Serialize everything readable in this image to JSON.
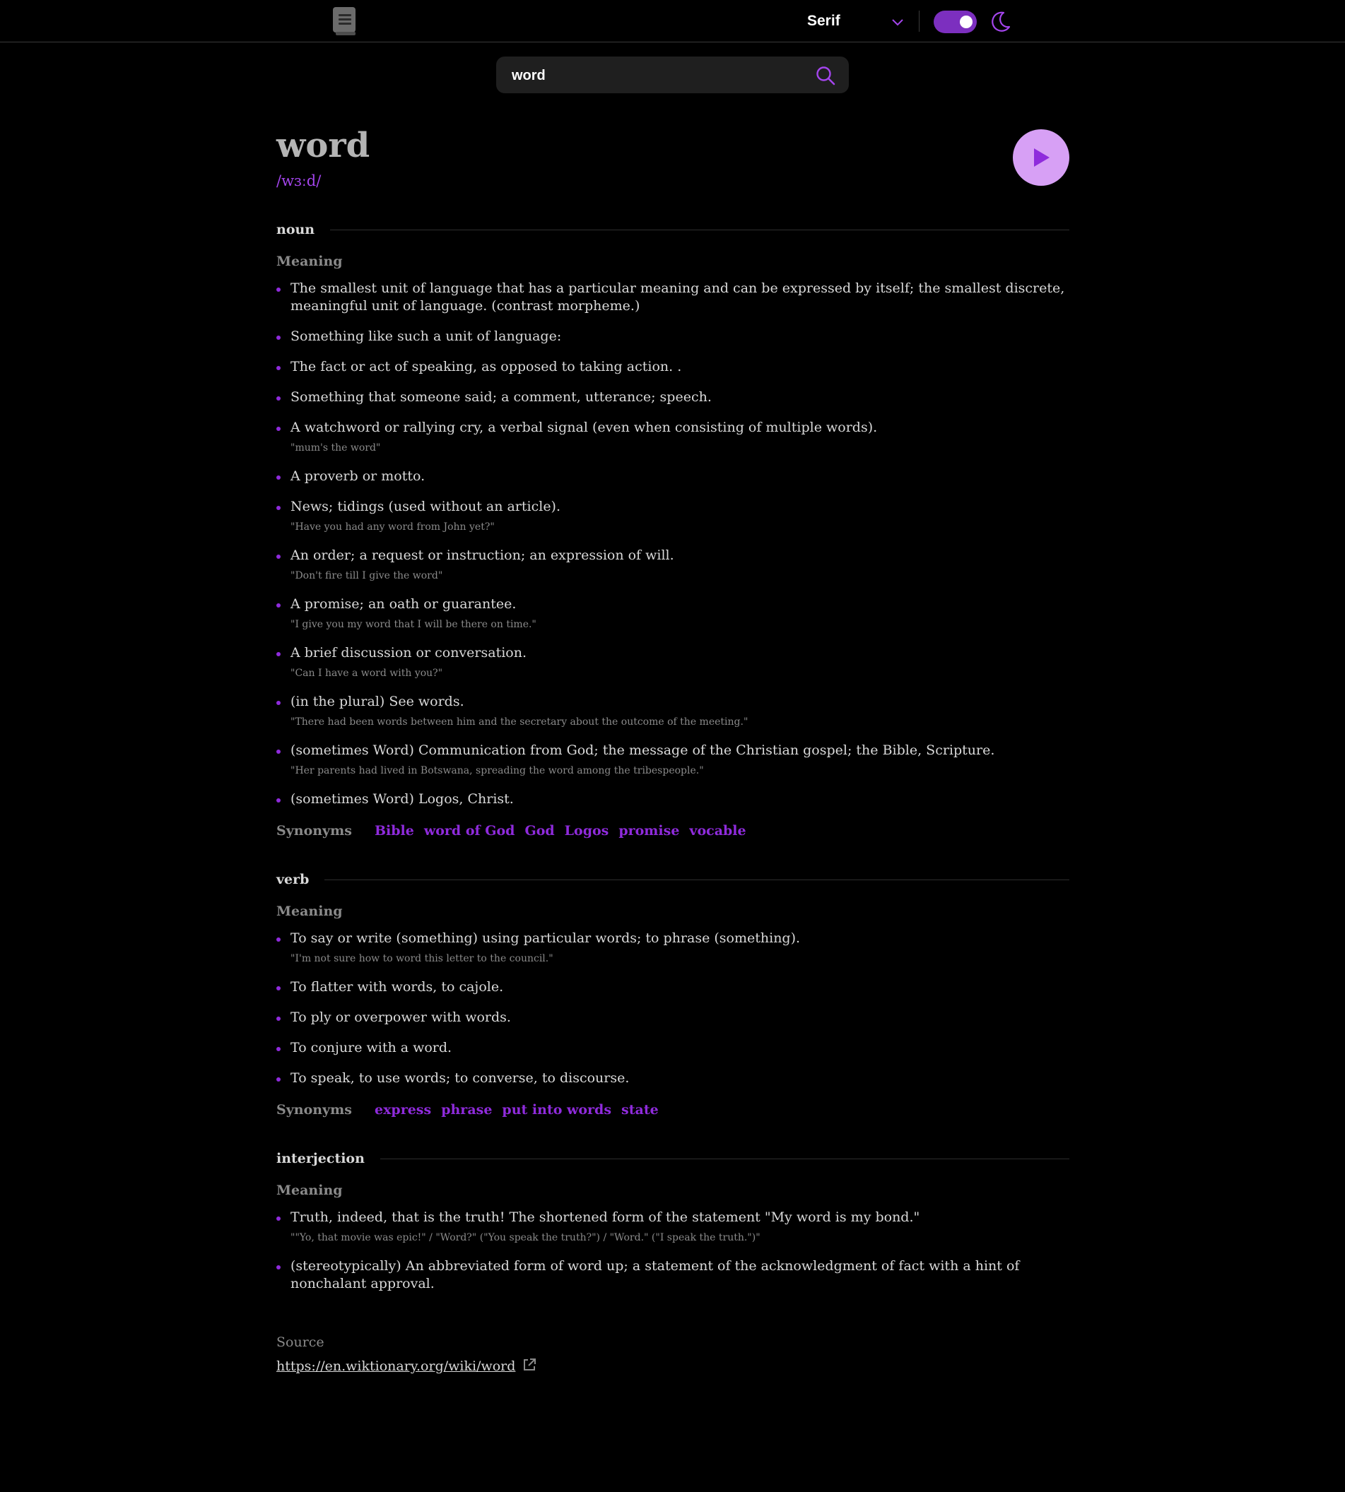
{
  "header": {
    "font_select_value": "Serif"
  },
  "search": {
    "value": "word"
  },
  "entry": {
    "word": "word",
    "phonetic": "/wɜːd/",
    "meanings": [
      {
        "pos": "noun",
        "meaning_label": "Meaning",
        "definitions": [
          {
            "text": "The smallest unit of language that has a particular meaning and can be expressed by itself; the smallest discrete, meaningful unit of language. (contrast morpheme.)",
            "example": ""
          },
          {
            "text": "Something like such a unit of language:",
            "example": ""
          },
          {
            "text": "The fact or act of speaking, as opposed to taking action. .",
            "example": ""
          },
          {
            "text": "Something that someone said; a comment, utterance; speech.",
            "example": ""
          },
          {
            "text": "A watchword or rallying cry, a verbal signal (even when consisting of multiple words).",
            "example": "\"mum's the word\""
          },
          {
            "text": "A proverb or motto.",
            "example": ""
          },
          {
            "text": "News; tidings (used without an article).",
            "example": "\"Have you had any word from John yet?\""
          },
          {
            "text": "An order; a request or instruction; an expression of will.",
            "example": "\"Don't fire till I give the word\""
          },
          {
            "text": "A promise; an oath or guarantee.",
            "example": "\"I give you my word that I will be there on time.\""
          },
          {
            "text": "A brief discussion or conversation.",
            "example": "\"Can I have a word with you?\""
          },
          {
            "text": "(in the plural) See words.",
            "example": "\"There had been words between him and the secretary about the outcome of the meeting.\""
          },
          {
            "text": "(sometimes Word) Communication from God; the message of the Christian gospel; the Bible, Scripture.",
            "example": "\"Her parents had lived in Botswana, spreading the word among the tribespeople.\""
          },
          {
            "text": "(sometimes Word) Logos, Christ.",
            "example": ""
          }
        ],
        "synonyms_label": "Synonyms",
        "synonyms": [
          "Bible",
          "word of God",
          "God",
          "Logos",
          "promise",
          "vocable"
        ]
      },
      {
        "pos": "verb",
        "meaning_label": "Meaning",
        "definitions": [
          {
            "text": "To say or write (something) using particular words; to phrase (something).",
            "example": "\"I'm not sure how to word this letter to the council.\""
          },
          {
            "text": "To flatter with words, to cajole.",
            "example": ""
          },
          {
            "text": "To ply or overpower with words.",
            "example": ""
          },
          {
            "text": "To conjure with a word.",
            "example": ""
          },
          {
            "text": "To speak, to use words; to converse, to discourse.",
            "example": ""
          }
        ],
        "synonyms_label": "Synonyms",
        "synonyms": [
          "express",
          "phrase",
          "put into words",
          "state"
        ]
      },
      {
        "pos": "interjection",
        "meaning_label": "Meaning",
        "definitions": [
          {
            "text": "Truth, indeed, that is the truth! The shortened form of the statement \"My word is my bond.\"",
            "example": "\"\"Yo, that movie was epic!\" / \"Word?\" (\"You speak the truth?\") / \"Word.\" (\"I speak the truth.\")\""
          },
          {
            "text": "(stereotypically) An abbreviated form of word up; a statement of the acknowledgment of fact with a hint of nonchalant approval.",
            "example": ""
          }
        ],
        "synonyms_label": "",
        "synonyms": []
      }
    ]
  },
  "source": {
    "label": "Source",
    "url": "https://en.wiktionary.org/wiki/word"
  },
  "icons": {
    "logo": "book-icon",
    "dropdown": "chevron-down-icon",
    "theme": "moon-icon",
    "search": "search-icon",
    "play": "play-icon",
    "external": "external-link-icon"
  },
  "colors": {
    "accent": "#a445ed",
    "accent_dark": "#8f2bdc",
    "toggle_on": "#7c2fbf",
    "background": "#000000",
    "play_bg": "#d7a0f5"
  }
}
